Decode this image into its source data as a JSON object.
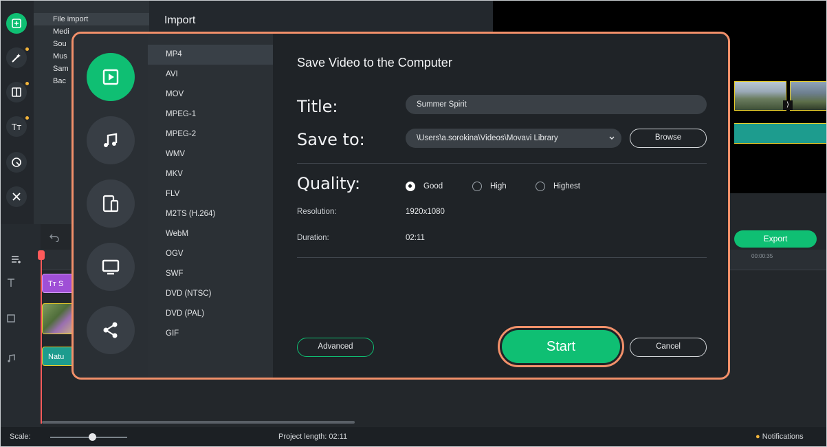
{
  "import_panel": {
    "title": "Import",
    "categories": [
      {
        "label": "File import"
      },
      {
        "label": "Medi"
      },
      {
        "label": "Sou"
      },
      {
        "label": "Mus"
      },
      {
        "label": "Sam"
      },
      {
        "label": "Bac"
      }
    ]
  },
  "rail": {
    "items": [
      {
        "icon": "import-icon",
        "active": true,
        "dot": false
      },
      {
        "icon": "magic-wand-icon",
        "active": false,
        "dot": true
      },
      {
        "icon": "transitions-icon",
        "active": false,
        "dot": true
      },
      {
        "icon": "titles-icon",
        "active": false,
        "dot": true
      },
      {
        "icon": "stickers-icon",
        "active": false,
        "dot": false
      },
      {
        "icon": "tools-icon",
        "active": false,
        "dot": false
      }
    ]
  },
  "timeline": {
    "title_clip_label": "Tт S",
    "audio_clip_label": "Natu",
    "ruler_time_right": "00:00:35",
    "transition_glyph": "⟩"
  },
  "player": {
    "export_label": "Export"
  },
  "statusbar": {
    "scale_label": "Scale:",
    "project_length": "Project length: 02:11",
    "notifications": "Notifications"
  },
  "dialog": {
    "heading": "Save Video to the Computer",
    "sidebar": [
      {
        "icon": "video-icon",
        "active": true
      },
      {
        "icon": "music-note-icon",
        "active": false
      },
      {
        "icon": "devices-icon",
        "active": false
      },
      {
        "icon": "monitor-icon",
        "active": false
      },
      {
        "icon": "share-icon",
        "active": false
      }
    ],
    "formats": [
      "MP4",
      "AVI",
      "MOV",
      "MPEG-1",
      "MPEG-2",
      "WMV",
      "MKV",
      "FLV",
      "M2TS (H.264)",
      "WebM",
      "OGV",
      "SWF",
      "DVD (NTSC)",
      "DVD (PAL)",
      "GIF"
    ],
    "selected_format": "MP4",
    "title_label": "Title:",
    "title_value": "Summer Spirit",
    "save_to_label": "Save to:",
    "save_to_value": "\\Users\\a.sorokina\\Videos\\Movavi Library",
    "browse_label": "Browse",
    "quality_label": "Quality:",
    "quality_options": [
      "Good",
      "High",
      "Highest"
    ],
    "quality_selected": "Good",
    "resolution_label": "Resolution:",
    "resolution_value": "1920x1080",
    "duration_label": "Duration:",
    "duration_value": "02:11",
    "advanced_label": "Advanced",
    "start_label": "Start",
    "cancel_label": "Cancel"
  },
  "colors": {
    "accent_green": "#0fbf73",
    "highlight_orange": "#f2906a",
    "background_dark": "#262b30"
  }
}
